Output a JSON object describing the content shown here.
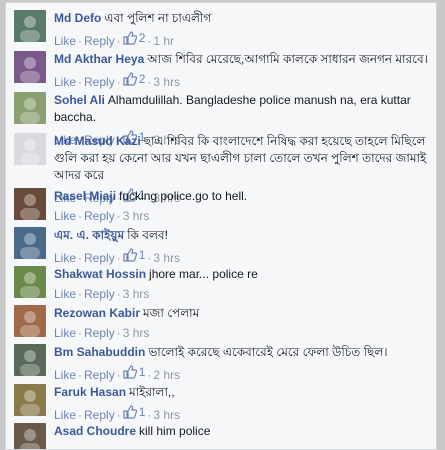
{
  "comments": [
    {
      "author": "Md Defo",
      "text": "এবা পুলিশ না চাএলীগ",
      "likes": "2",
      "time": "1 hr",
      "color": "#5a7a6a"
    },
    {
      "author": "Md Akthar Heya",
      "text": "আজ শিবির মেরেছে,আগামি কালকে সাধারন জনগন মারবে।",
      "likes": "2",
      "time": "3 hrs",
      "color": "#7a5a8a"
    },
    {
      "author": "Sohel Ali",
      "text": "Alhamdulillah. Bangladeshe police manush na, era kuttar baccha.",
      "likes": "1",
      "time": "3 hrs",
      "color": "#8aa070"
    },
    {
      "author": "Md Masud Kazi",
      "text": "ছাএ শিবির কি বাংলাদেশে নিষিদ্ধ করা হয়েছে তাহলে মিছিলে গুলি করা হয় কেনো আর যখন ছাএলীগ চালা তোলে তখন পুলিশ তাদের জামাই আদর করে",
      "likes": "1",
      "time": "3 hrs",
      "color": "#d8dadf"
    },
    {
      "author": "Rasel Miaji",
      "text": "fucking police.go to hell.",
      "likes": "",
      "time": "3 hrs",
      "color": "#6a4a3a"
    },
    {
      "author": "এম. এ. কাইয়ুম",
      "text": "কি বলব!",
      "likes": "1",
      "time": "3 hrs",
      "color": "#4a6a8a"
    },
    {
      "author": "Shakwat Hossin",
      "text": "jhore mar... police re",
      "likes": "",
      "time": "3 hrs",
      "color": "#6a8a4a"
    },
    {
      "author": "Rezowan Kabir",
      "text": "মজা পেলাম",
      "likes": "",
      "time": "3 hrs",
      "color": "#a06a4a"
    },
    {
      "author": "Bm Sahabuddin",
      "text": "ভালোই করেছে একেবারেই মেরে ফেলা উচিত ছিল।",
      "likes": "1",
      "time": "2 hrs",
      "color": "#5a6a5a"
    },
    {
      "author": "Faruk Hasan",
      "text": "মাইরালা,,",
      "likes": "1",
      "time": "3 hrs",
      "color": "#8a7a4a"
    },
    {
      "author": "Asad Choudre",
      "text": "kill him police",
      "likes": "",
      "time": "",
      "color": "#6a5a4a"
    }
  ],
  "labels": {
    "like": "Like",
    "reply": "Reply",
    "dot": "·"
  },
  "colors": {
    "author": "#3b5998",
    "link": "#6d84b4",
    "meta": "#9197a3"
  }
}
